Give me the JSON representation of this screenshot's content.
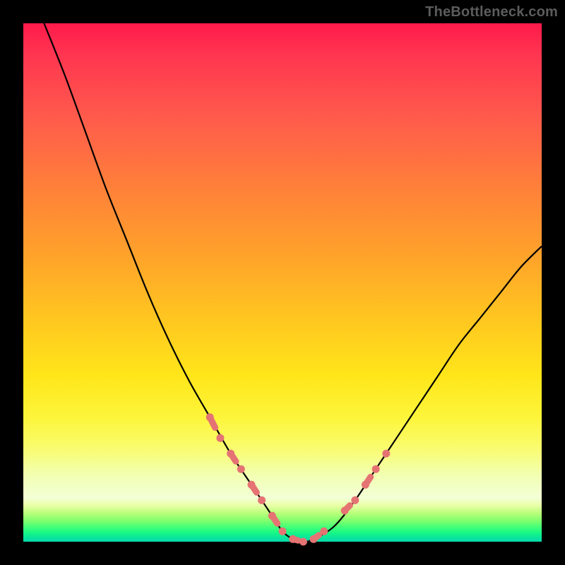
{
  "watermark": "TheBottleneck.com",
  "colors": {
    "frame": "#000000",
    "curve": "#000000",
    "markers": "#e57373",
    "gradient_top": "#ff1a4b",
    "gradient_bottom": "#07d9ab"
  },
  "chart_data": {
    "type": "line",
    "title": "",
    "xlabel": "",
    "ylabel": "",
    "xlim": [
      0,
      100
    ],
    "ylim": [
      0,
      100
    ],
    "series": [
      {
        "name": "bottleneck-curve",
        "x": [
          4,
          8,
          12,
          16,
          20,
          24,
          28,
          32,
          36,
          40,
          44,
          48,
          50,
          52,
          54,
          56,
          60,
          64,
          68,
          72,
          76,
          80,
          84,
          88,
          92,
          96,
          100
        ],
        "y": [
          100,
          90,
          79,
          68,
          58,
          48,
          39,
          31,
          24,
          17,
          11,
          5,
          2,
          0.5,
          0,
          0.5,
          3,
          8,
          14,
          20,
          26,
          32,
          38,
          43,
          48,
          53,
          57
        ]
      }
    ],
    "markers": {
      "name": "highlighted-points",
      "x": [
        36,
        38,
        40,
        42,
        44,
        46,
        48,
        50,
        52,
        54,
        56,
        58,
        62,
        64,
        66,
        68,
        70
      ],
      "y": [
        24,
        20,
        17,
        14,
        11,
        8,
        5,
        2,
        0.5,
        0,
        0.5,
        2,
        6,
        8,
        11,
        14,
        17
      ]
    }
  }
}
